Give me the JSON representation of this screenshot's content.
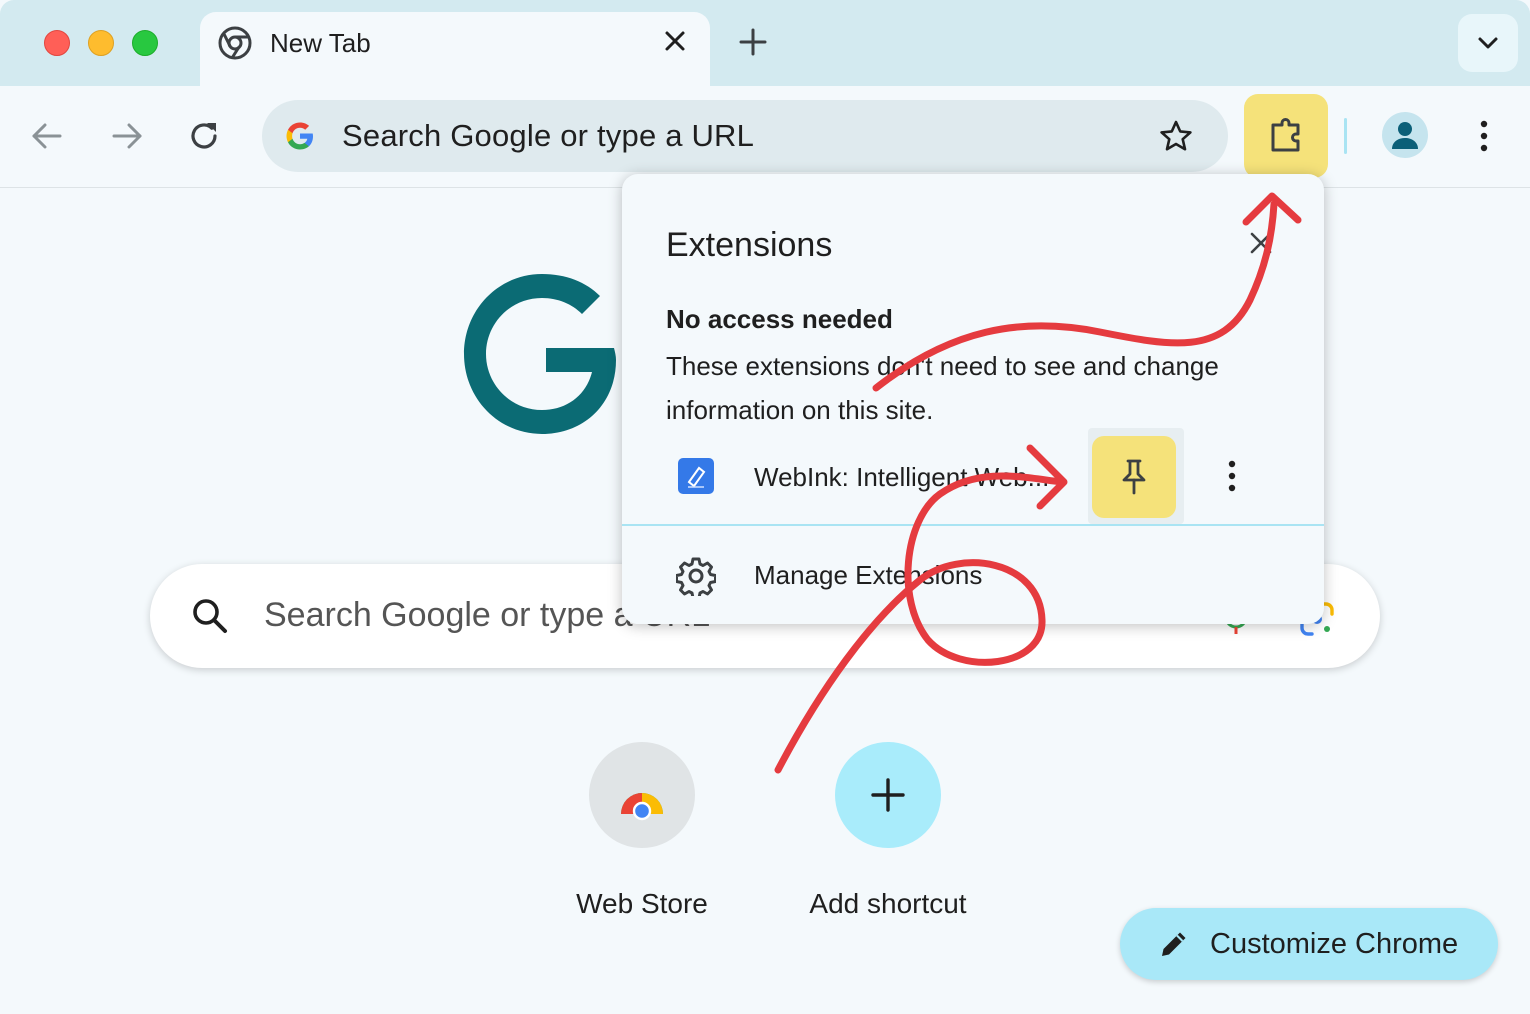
{
  "tab": {
    "title": "New Tab"
  },
  "omnibox": {
    "placeholder": "Search Google or type a URL"
  },
  "ntp": {
    "search_placeholder": "Search Google or type a URL",
    "shortcuts": [
      {
        "label": "Web Store"
      },
      {
        "label": "Add shortcut"
      }
    ],
    "customize_label": "Customize Chrome"
  },
  "extensions_popup": {
    "title": "Extensions",
    "section_heading": "No access needed",
    "section_description": "These extensions don't need to see and change information on this site.",
    "items": [
      {
        "name": "WebInk: Intelligent Web..."
      }
    ],
    "manage_label": "Manage Extensions"
  },
  "colors": {
    "tabstrip": "#d3eaf0",
    "highlight": "#f5e27a",
    "accent": "#a9e8f8",
    "annotation": "#e53b3f",
    "logo": "#0b6b74"
  }
}
